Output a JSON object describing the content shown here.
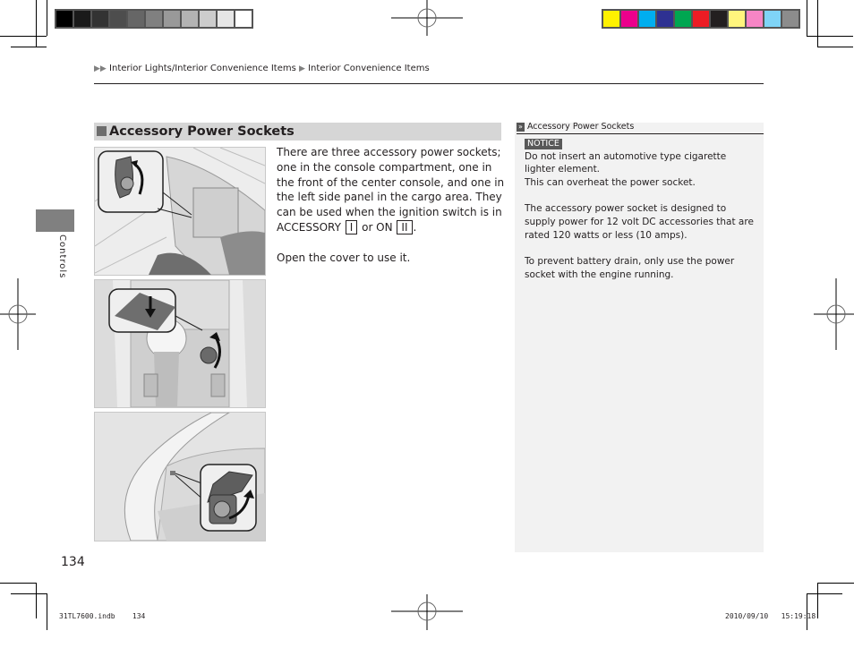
{
  "print_marks": {
    "gray_swatches": [
      "#000000",
      "#1a1a1a",
      "#333333",
      "#4d4d4d",
      "#666666",
      "#808080",
      "#999999",
      "#b3b3b3",
      "#cccccc",
      "#e6e6e6",
      "#ffffff"
    ],
    "color_swatches": [
      "#fff100",
      "#ec008c",
      "#00aeef",
      "#2e3192",
      "#00a651",
      "#ed1c24",
      "#231f20",
      "#fff57d",
      "#f685c5",
      "#7fd4f7",
      "#8c8c8c"
    ]
  },
  "breadcrumb": {
    "items": [
      "Interior Lights/Interior Convenience Items",
      "Interior Convenience Items"
    ]
  },
  "section": {
    "title": "Accessory Power Sockets"
  },
  "main": {
    "paragraph1_a": "There are three accessory power sockets; one in the console compartment, one in the front of the center console, and one in the left side panel in the cargo area. They can be used when the ignition switch is in ACCESSORY ",
    "key_accessory": "I",
    "or_on": " or ON ",
    "key_on": "II",
    "period": ".",
    "paragraph2": "Open the cover to use it."
  },
  "illustrations": [
    {
      "name": "console-compartment-socket"
    },
    {
      "name": "center-console-front-socket"
    },
    {
      "name": "cargo-area-socket"
    }
  ],
  "sidebar": {
    "heading": "Accessory Power Sockets",
    "notice_label": "NOTICE",
    "notice_text_1": "Do not insert an automotive type cigarette lighter element.",
    "notice_text_2": "This can overheat the power socket.",
    "para_rating": "The accessory power socket is designed to supply power for 12 volt DC accessories that are rated 120 watts or less (10 amps).",
    "para_drain": "To prevent battery drain, only use the power socket with the engine running."
  },
  "chapter_tab": {
    "label": "Controls",
    "color": "#808080"
  },
  "footer": {
    "page_number": "134",
    "slug_file": "31TL7600.indb",
    "slug_page": "134",
    "slug_date": "2010/09/10",
    "slug_time": "15:19:18"
  }
}
